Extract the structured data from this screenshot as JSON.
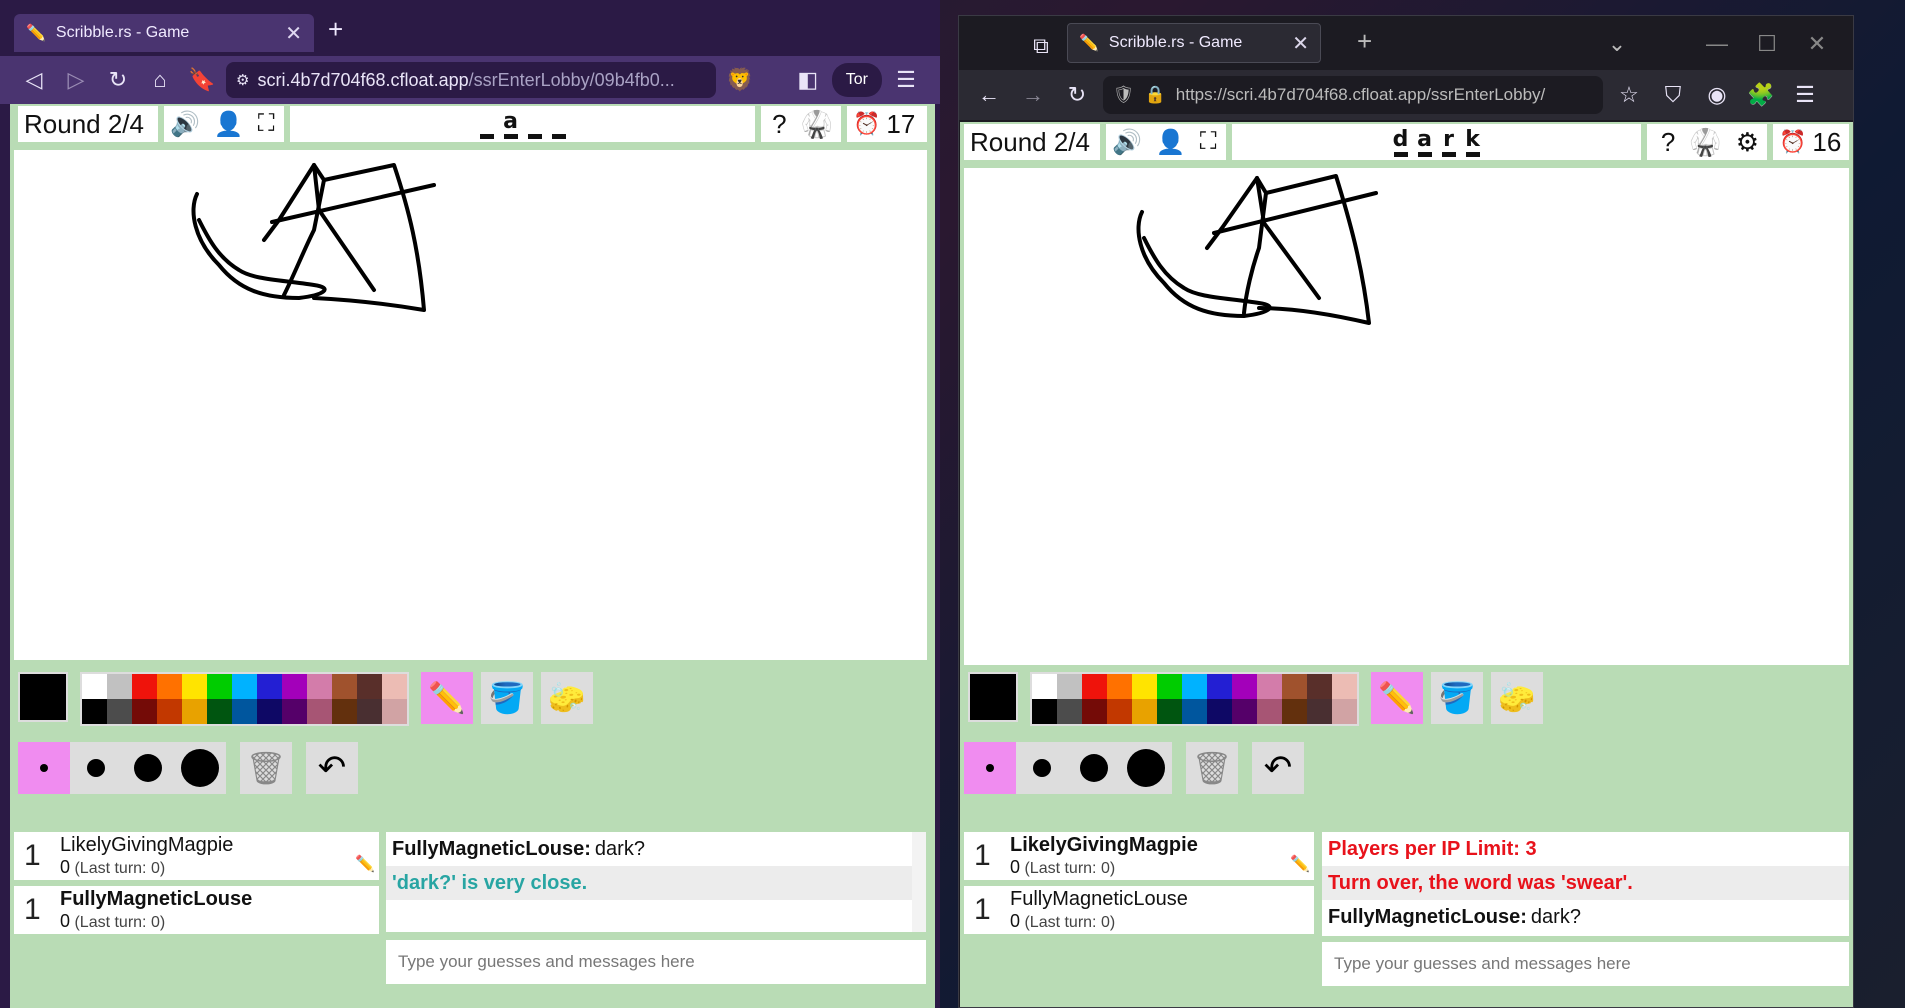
{
  "left_window": {
    "tab_title": "Scribble.rs - Game",
    "url_host": "scri.4b7d704f68.cfloat.app",
    "url_path": "/ssrEnterLobby/09b4fb0...",
    "tor_label": "Tor",
    "round": "Round 2/4",
    "word_hint": [
      "",
      "a",
      "",
      ""
    ],
    "timer": "17",
    "players": [
      {
        "rank": "1",
        "name": "LikelyGivingMagpie",
        "score": "0",
        "last_turn": "(Last turn: 0)",
        "drawing": true
      },
      {
        "rank": "1",
        "name": "FullyMagneticLouse",
        "score": "0",
        "last_turn": "(Last turn: 0)",
        "drawing": false
      }
    ],
    "chat": [
      {
        "who": "FullyMagneticLouse:",
        "text": "dark?"
      },
      {
        "text": "'dark?' is very close."
      }
    ],
    "chat_placeholder": "Type your guesses and messages here"
  },
  "right_window": {
    "tab_title": "Scribble.rs - Game",
    "url": "https://scri.4b7d704f68.cfloat.app/ssrEnterLobby/",
    "round": "Round 2/4",
    "word": [
      "d",
      "a",
      "r",
      "k"
    ],
    "timer": "16",
    "players": [
      {
        "rank": "1",
        "name": "LikelyGivingMagpie",
        "score": "0",
        "last_turn": "(Last turn: 0)",
        "drawing": true
      },
      {
        "rank": "1",
        "name": "FullyMagneticLouse",
        "score": "0",
        "last_turn": "(Last turn: 0)",
        "drawing": false
      }
    ],
    "chat": [
      {
        "text": "Players per IP Limit: 3"
      },
      {
        "text": "Turn over, the word was 'swear'."
      },
      {
        "who": "FullyMagneticLouse:",
        "text": "dark?"
      }
    ],
    "chat_placeholder": "Type your guesses and messages here"
  },
  "palette_colors": {
    "top": [
      "#ffffff",
      "#c1c1c1",
      "#ef130b",
      "#ff7100",
      "#ffe400",
      "#00cc00",
      "#00b2ff",
      "#231fd3",
      "#a300ba",
      "#d37caa",
      "#a0522d",
      "#592f2a",
      "#ecbcb4"
    ],
    "bottom": [
      "#000000",
      "#4c4c4c",
      "#740b07",
      "#c23800",
      "#e8a200",
      "#005510",
      "#00569e",
      "#0e0865",
      "#550069",
      "#a75574",
      "#63300d",
      "#492f31",
      "#d1a3a4"
    ]
  },
  "colors": {
    "game_bg": "#b9dcb5",
    "active_tool": "#f08cf0",
    "close_guess": "#28a5a3",
    "system_msg": "#e8121b"
  }
}
